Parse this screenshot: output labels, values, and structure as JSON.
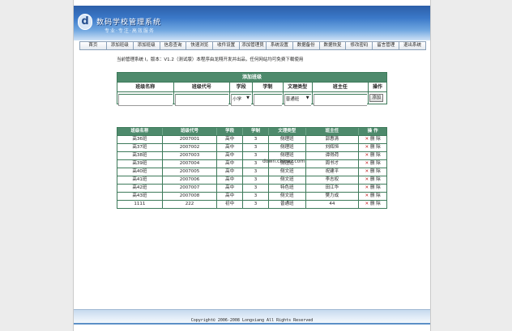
{
  "header": {
    "logo_glyph": "d",
    "title": "数码学校管理系统",
    "subtitle": "专业·专注·高效服务"
  },
  "nav": [
    "首页",
    "添加班级",
    "添加班级",
    "信息查询",
    "快速浏览",
    "收件设置",
    "添加管理员",
    "系统设置",
    "数据备份",
    "数据恢复",
    "修改密码",
    "留言管理",
    "退出系统"
  ],
  "notice": "当前管理系统 Ⅰ，版本：V1.2（测试版）本程序由龙翔开发并出品，任何网站均可免费下载使用",
  "watermark": "down.chinaz.com",
  "form": {
    "title": "添加班级",
    "headers": [
      "班级名称",
      "班级代号",
      "学段",
      "学制",
      "文理类型",
      "班主任",
      "操作"
    ],
    "stage_value": "小学",
    "type_value": "普通班",
    "add_label": "添加"
  },
  "list": {
    "headers": [
      "班级名称",
      "班级代号",
      "学段",
      "学制",
      "文理类型",
      "班主任",
      "操 作"
    ],
    "delete_label": "删 除",
    "rows": [
      [
        "高36班",
        "2007001",
        "高中",
        "3",
        "侧理班",
        "郭惠清"
      ],
      [
        "高37班",
        "2007002",
        "高中",
        "3",
        "侧理班",
        "刘辉恒"
      ],
      [
        "高38班",
        "2007003",
        "高中",
        "3",
        "侧理班",
        "谭得荷"
      ],
      [
        "高39班",
        "2007004",
        "高中",
        "3",
        "侧理班",
        "周书才"
      ],
      [
        "高40班",
        "2007005",
        "高中",
        "3",
        "侧文班",
        "祝建平"
      ],
      [
        "高41班",
        "2007006",
        "高中",
        "3",
        "侧文班",
        "李志权"
      ],
      [
        "高42班",
        "2007007",
        "高中",
        "3",
        "特色班",
        "田江华"
      ],
      [
        "高43班",
        "2007008",
        "高中",
        "3",
        "侧文班",
        "樊力成"
      ],
      [
        "1111",
        "222",
        "初中",
        "3",
        "普通班",
        "44"
      ]
    ]
  },
  "footer": "Copyright© 2006-2008 Longxiang All Rights Reserved",
  "colors": {
    "header_blue": "#3a78c8",
    "table_green": "#4e8a6c",
    "delete_red": "#c02020"
  }
}
